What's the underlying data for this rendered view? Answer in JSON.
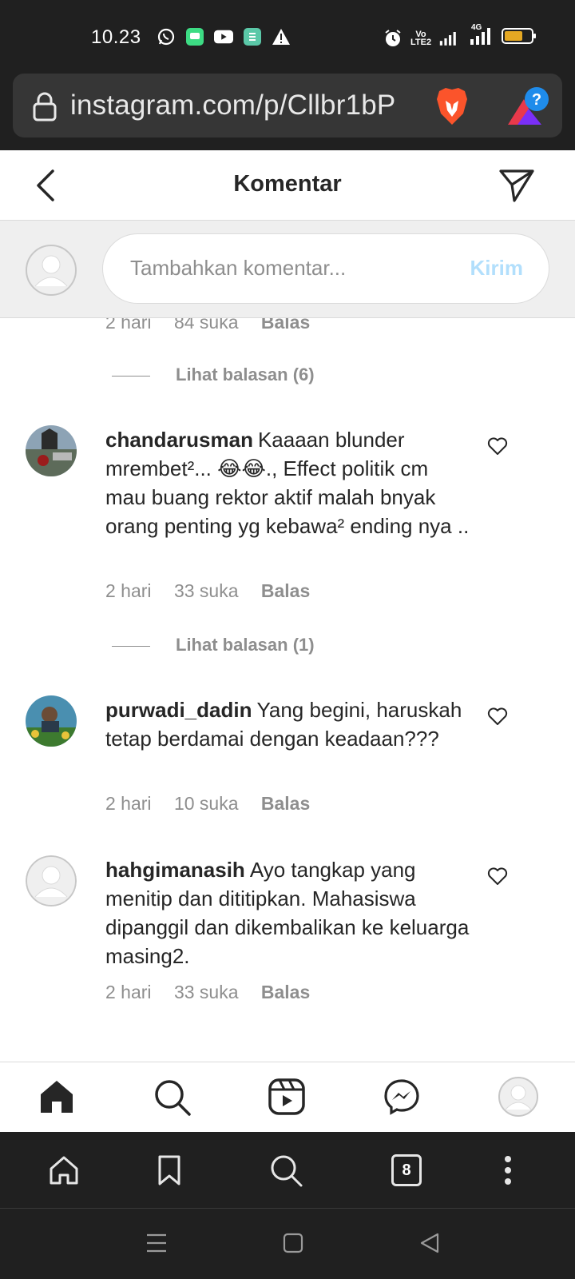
{
  "status_bar": {
    "time": "10.23",
    "network_label": "4G",
    "volte_label": "Vo LTE2"
  },
  "browser": {
    "url": "instagram.com/p/Cllbr1bP",
    "tab_count": "8",
    "extension_badge": "?"
  },
  "header": {
    "title": "Komentar"
  },
  "comment_input": {
    "placeholder": "Tambahkan komentar...",
    "submit_label": "Kirim"
  },
  "partial_comment": {
    "time": "2 hari",
    "likes": "84 suka",
    "reply": "Balas",
    "view_replies": "Lihat balasan (6)"
  },
  "comments": [
    {
      "username": "chandarusman",
      "text": "Kaaaan blunder mrembet²... 😂😂., Effect politik cm mau buang rektor aktif malah bnyak orang penting yg kebawa² ending nya ..",
      "time": "2 hari",
      "likes": "33 suka",
      "reply": "Balas",
      "view_replies": "Lihat balasan (1)"
    },
    {
      "username": "purwadi_dadin",
      "text": "Yang begini, haruskah tetap berdamai dengan keadaan???",
      "time": "2 hari",
      "likes": "10 suka",
      "reply": "Balas"
    },
    {
      "username": "hahgimanasih",
      "text": "Ayo tangkap yang menitip dan dititipkan. Mahasiswa dipanggil dan dikembalikan ke keluarga masing2.",
      "time": "2 hari",
      "likes": "33 suka",
      "reply": "Balas"
    }
  ],
  "colors": {
    "brand_blue_disabled": "#b2dffc",
    "secondary_text": "#8e8e8e",
    "browser_chrome": "#202020"
  }
}
